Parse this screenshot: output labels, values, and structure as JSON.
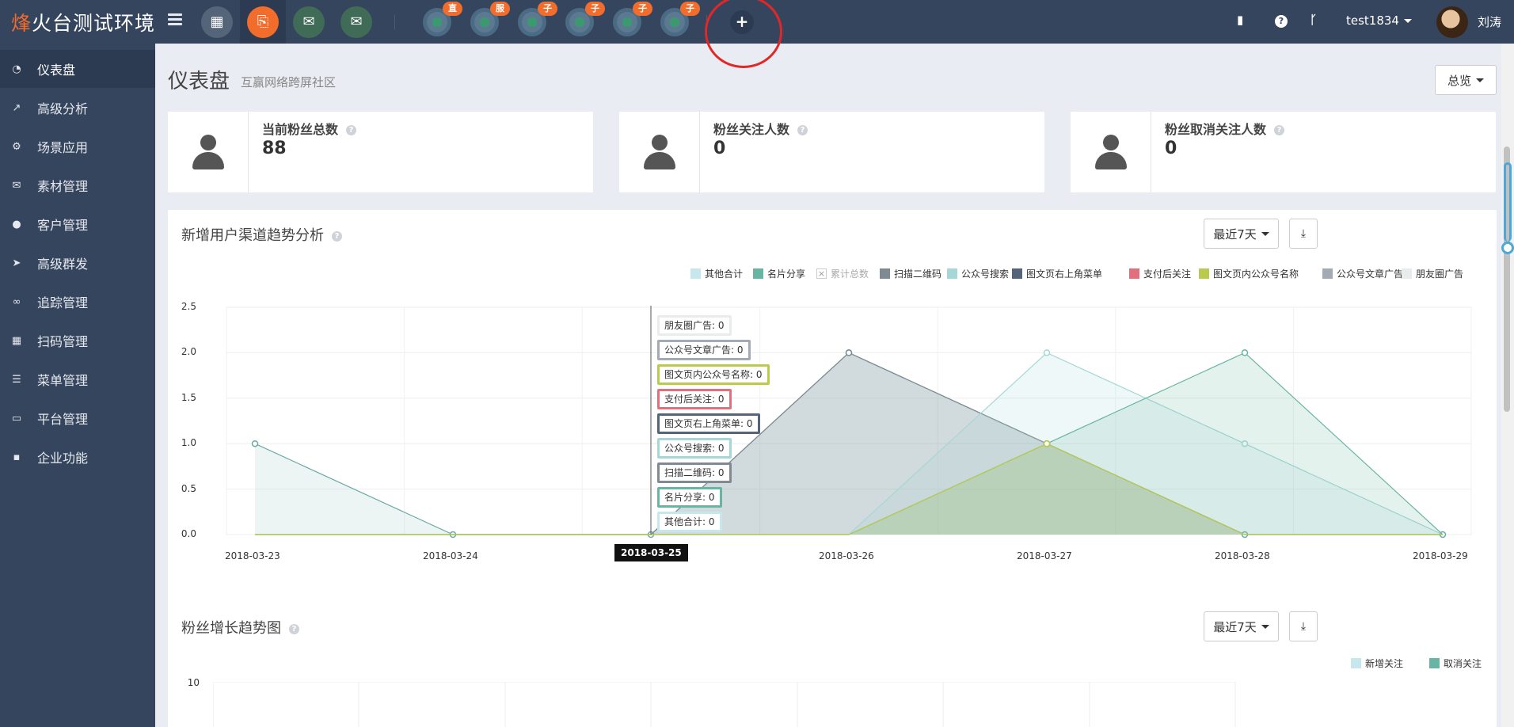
{
  "app": {
    "brand_first": "烽",
    "brand_rest": "火台测试环境"
  },
  "topbar": {
    "sub_accounts": [
      "直",
      "服",
      "子",
      "子",
      "子",
      "子"
    ],
    "add_label": "+",
    "username": "test1834",
    "real_name": "刘涛",
    "icons": [
      "book-icon",
      "help-icon",
      "branch-icon"
    ]
  },
  "sidebar": {
    "items": [
      {
        "label": "仪表盘",
        "icon": "dashboard-icon"
      },
      {
        "label": "高级分析",
        "icon": "line-chart-icon"
      },
      {
        "label": "场景应用",
        "icon": "gear-icon"
      },
      {
        "label": "素材管理",
        "icon": "envelope-icon"
      },
      {
        "label": "客户管理",
        "icon": "user-icon"
      },
      {
        "label": "高级群发",
        "icon": "paper-plane-icon"
      },
      {
        "label": "追踪管理",
        "icon": "link-icon"
      },
      {
        "label": "扫码管理",
        "icon": "qrcode-icon"
      },
      {
        "label": "菜单管理",
        "icon": "list-icon"
      },
      {
        "label": "平台管理",
        "icon": "desktop-icon"
      },
      {
        "label": "企业功能",
        "icon": "grid-icon"
      }
    ]
  },
  "page": {
    "title": "仪表盘",
    "subtitle": "互赢网络跨屏社区",
    "overview_label": "总览"
  },
  "stats": [
    {
      "label": "当前粉丝总数",
      "value": "88"
    },
    {
      "label": "粉丝关注人数",
      "value": "0"
    },
    {
      "label": "粉丝取消关注人数",
      "value": "0"
    }
  ],
  "panel1": {
    "title": "新增用户渠道趋势分析",
    "range_label": "最近7天",
    "hover_date": "2018-03-25"
  },
  "panel2": {
    "title": "粉丝增长趋势图",
    "range_label": "最近7天",
    "legend": [
      "新增关注",
      "取消关注"
    ],
    "y_top": "10"
  },
  "colors": {
    "sidebar": "#36455e",
    "accent": "#f26c2c",
    "highlight": "#e32626"
  },
  "chart_data": {
    "type": "area",
    "x": [
      "2018-03-23",
      "2018-03-24",
      "2018-03-25",
      "2018-03-26",
      "2018-03-27",
      "2018-03-28",
      "2018-03-29"
    ],
    "ylim": [
      0,
      2.5
    ],
    "yticks": [
      "0.0",
      "0.5",
      "1.0",
      "1.5",
      "2.0",
      "2.5"
    ],
    "legend_position": "top-right",
    "series": [
      {
        "name": "其他合计",
        "color": "#c6e7ec",
        "values": [
          0,
          0,
          0,
          0,
          0,
          0,
          0
        ]
      },
      {
        "name": "名片分享",
        "color": "#68b5a3",
        "values": [
          0,
          0,
          0,
          0,
          1,
          2,
          0
        ]
      },
      {
        "name": "累计总数",
        "color": "#cccccc",
        "values": [
          1,
          0,
          0,
          2,
          1,
          0,
          0
        ],
        "disabled": true
      },
      {
        "name": "扫描二维码",
        "color": "#7f8a93",
        "values": [
          0,
          0,
          0,
          2,
          1,
          0,
          0
        ]
      },
      {
        "name": "公众号搜索",
        "color": "#a5d7d6",
        "values": [
          0,
          0,
          0,
          0,
          2,
          1,
          0
        ]
      },
      {
        "name": "图文页右上角菜单",
        "color": "#556579",
        "values": [
          0,
          0,
          0,
          0,
          0,
          0,
          0
        ]
      },
      {
        "name": "支付后关注",
        "color": "#e0707c",
        "values": [
          0,
          0,
          0,
          0,
          0,
          0,
          0
        ]
      },
      {
        "name": "图文页内公众号名称",
        "color": "#bbc94c",
        "values": [
          0,
          0,
          0,
          0,
          1,
          0,
          0
        ]
      },
      {
        "name": "公众号文章广告",
        "color": "#a3aab4",
        "values": [
          0,
          0,
          0,
          0,
          0,
          0,
          0
        ]
      },
      {
        "name": "朋友圈广告",
        "color": "#e8ecec",
        "values": [
          0,
          0,
          0,
          0,
          0,
          0,
          0
        ]
      }
    ],
    "tooltip": [
      {
        "label": "朋友圈广告",
        "value": "0"
      },
      {
        "label": "公众号文章广告",
        "value": "0"
      },
      {
        "label": "图文页内公众号名称",
        "value": "0"
      },
      {
        "label": "支付后关注",
        "value": "0"
      },
      {
        "label": "图文页右上角菜单",
        "value": "0"
      },
      {
        "label": "公众号搜索",
        "value": "0"
      },
      {
        "label": "扫描二维码",
        "value": "0"
      },
      {
        "label": "名片分享",
        "value": "0"
      },
      {
        "label": "其他合计",
        "value": "0"
      }
    ]
  }
}
